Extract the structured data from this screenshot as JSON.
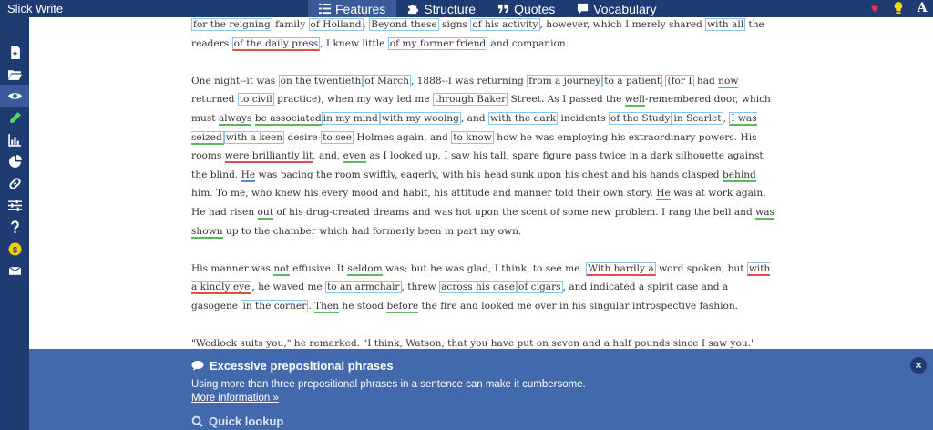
{
  "app": {
    "title": "Slick Write"
  },
  "tabs": [
    {
      "label": "Features",
      "icon": "list-icon",
      "active": true
    },
    {
      "label": "Structure",
      "icon": "puzzle-icon",
      "active": false
    },
    {
      "label": "Quotes",
      "icon": "quote-icon",
      "active": false
    },
    {
      "label": "Vocabulary",
      "icon": "speech-bubble-icon",
      "active": false
    }
  ],
  "top_icons": [
    "heart-icon",
    "lightbulb-icon",
    "font-size-icon"
  ],
  "top_icon_glyphs": {
    "heart": "♥",
    "bulb": "💡",
    "font": "A"
  },
  "sidebar": {
    "items": [
      "new-document-icon",
      "open-folder-icon",
      "eye-icon",
      "pencil-icon",
      "bar-chart-icon",
      "pie-chart-icon",
      "link-icon",
      "sliders-icon",
      "help-icon",
      "dollar-icon",
      "envelope-icon"
    ],
    "active_index": 2
  },
  "text": {
    "p1": {
      "s1": "for the reigning",
      "t1": " family ",
      "s2": "of Holland",
      "t2": ". ",
      "s3": "Beyond these",
      "t3": " signs ",
      "s4": "of his activity",
      "t4": ", however, which I merely shared ",
      "s5": "with all",
      "t5": " the readers ",
      "s6": "of the daily press",
      "t6": ", I knew little ",
      "s7": "of my former friend",
      "t7": " and companion."
    },
    "p2": {
      "t1": "One night--it was ",
      "s1": "on the twentieth",
      "s2": "of March",
      "t2": ", 1888--I was returning ",
      "s3": "from a journey",
      "s4": "to a patient",
      "t3": " ",
      "s5": "(for I",
      "t4": " had ",
      "s6": "now",
      "t5": " returned ",
      "s7": "to civil",
      "t6": " practice), when my way led me ",
      "s8": "through Baker",
      "t7": " Street. As I passed the ",
      "s9": "well",
      "t8": "-remembered door, which must ",
      "s10": "always",
      "t9": " ",
      "s11": "be associated",
      "s12": "in my mind",
      "s13": "with my wooing",
      "t10": ", and ",
      "s14": "with the dark",
      "t11": " incidents ",
      "s15": "of the Study",
      "s16": "in Scarlet",
      "t12": ", ",
      "s17": "I was seized",
      "s18": "with a keen",
      "t13": " desire ",
      "s19": "to see",
      "t14": " Holmes again, and ",
      "s20": "to know",
      "t15": " how he was employing his extraordinary powers. His rooms ",
      "s21": "were brilliantly lit",
      "t16": ", and, ",
      "s22": "even",
      "t17": " as I looked up, I saw his tall, spare figure pass twice in a dark silhouette against the blind. ",
      "s23": "He",
      "t18": " was pacing the room swiftly, eagerly, with his head sunk upon his chest and his hands clasped ",
      "s24": "behind",
      "t19": " him. To me, who knew his every mood and habit, his attitude and manner told their own story. ",
      "s25": "He",
      "t20": " was at work again. He had risen ",
      "s26": "out",
      "t21": " of his drug-created dreams and was hot upon the scent of some new problem. I rang the bell and ",
      "s27": "was shown",
      "t22": " up to the chamber which had formerly been in part my own."
    },
    "p3": {
      "t1": "His manner was ",
      "s1": "not",
      "t2": " effusive. It ",
      "s2": "seldom",
      "t3": " was; but he was glad, I think, to see me. ",
      "s3": "With hardly a",
      "t4": " word spoken, but ",
      "s4": "with a kindly eye",
      "t5": ", he waved me ",
      "s5": "to an armchair",
      "t6": ", threw ",
      "s6": "across his case",
      "s7": "of cigars",
      "t7": ", and indicated a spirit case and a gasogene ",
      "s8": "in the corner",
      "t8": ". ",
      "s9": "Then",
      "t9": " he stood ",
      "s10": "before",
      "t10": " the fire and looked me over in his singular introspective fashion."
    },
    "p4": "\"Wedlock suits you,\" he remarked. \"I think, Watson, that you have put on seven and a half pounds since I saw you.\""
  },
  "panel": {
    "heading": "Excessive prepositional phrases",
    "description": "Using more than three prepositional phrases in a sentence can make it cumbersome.",
    "link": "More information »",
    "lookup": "Quick lookup",
    "close": "×"
  },
  "colors": {
    "nav_bg": "#1f3c72",
    "nav_active": "#3a5a99",
    "panel_bg": "#4369ad",
    "prep_box": "#8ec4e8",
    "underline_green": "#5cb85c",
    "underline_blue": "#5b8fd6",
    "underline_red": "#e0504c",
    "heart": "#e8344a",
    "bulb": "#f5d800"
  }
}
